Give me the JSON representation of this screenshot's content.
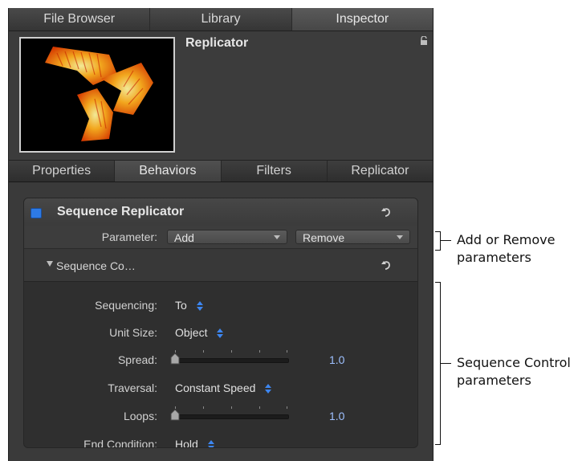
{
  "top_tabs": [
    "File Browser",
    "Library",
    "Inspector"
  ],
  "active_top_tab": "Inspector",
  "header": {
    "object_name": "Replicator"
  },
  "sub_tabs": [
    "Properties",
    "Behaviors",
    "Filters",
    "Replicator"
  ],
  "active_sub_tab": "Behaviors",
  "behavior": {
    "title": "Sequence Replicator",
    "parameter_label": "Parameter:",
    "add_label": "Add",
    "remove_label": "Remove",
    "group_label": "Sequence Co…",
    "rows": {
      "sequencing": {
        "label": "Sequencing:",
        "value": "To"
      },
      "unit_size": {
        "label": "Unit Size:",
        "value": "Object"
      },
      "spread": {
        "label": "Spread:",
        "value": "1.0"
      },
      "traversal": {
        "label": "Traversal:",
        "value": "Constant Speed"
      },
      "loops": {
        "label": "Loops:",
        "value": "1.0"
      },
      "end_condition": {
        "label": "End Condition:",
        "value": "Hold"
      }
    }
  },
  "annotations": {
    "add_remove": [
      "Add or Remove",
      "parameters"
    ],
    "sequence_control": [
      "Sequence Control",
      "parameters"
    ]
  },
  "colors": {
    "accent": "#3d86f0",
    "panel": "#3a3a3a",
    "enable": "#2d7ae6"
  },
  "icons": [
    "lock-icon",
    "reset-icon",
    "disclosure-triangle-icon",
    "stepper-icon",
    "slider-thumb-icon"
  ]
}
